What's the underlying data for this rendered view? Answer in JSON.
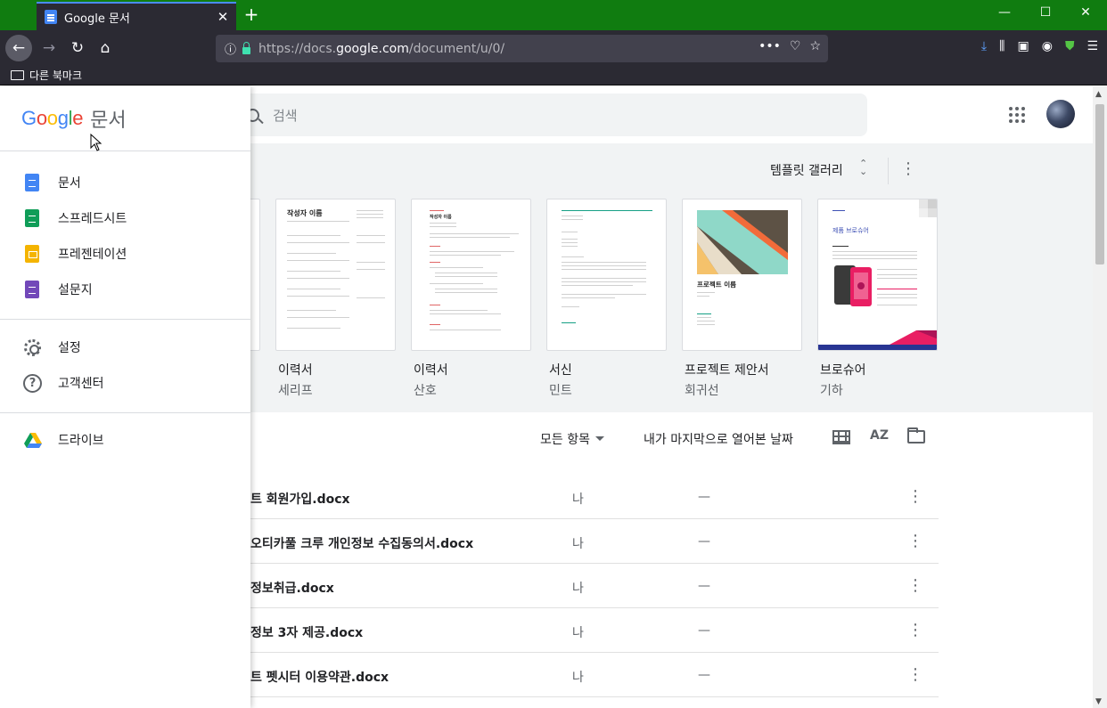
{
  "browser": {
    "tab_title": "Google 문서",
    "tab_close": "✕",
    "new_tab": "+",
    "window_controls": {
      "minimize": "—",
      "maximize": "☐",
      "close": "✕"
    },
    "nav": {
      "back": "←",
      "forward": "→",
      "reload": "↻",
      "home": "⌂"
    },
    "url_prefix": "https://docs.",
    "url_domain": "google.com",
    "url_suffix": "/document/u/0/",
    "url_actions": [
      "•••",
      "♡",
      "☆"
    ],
    "toolbar_icons": [
      "⤓",
      "⫼",
      "▣",
      "◉",
      "⛊",
      "☰"
    ],
    "bookmark_folder": "다른 북마크",
    "accent_color": "#107c10"
  },
  "search": {
    "placeholder": "검색"
  },
  "gallery": {
    "label": "템플릿 갤러리",
    "arrows": "⌃⌄",
    "more": "⋮"
  },
  "templates": [
    {
      "name": "이력서",
      "sub": "세리프",
      "heading": "작성자 이름"
    },
    {
      "name": "이력서",
      "sub": "산호",
      "heading": "작성자 이름"
    },
    {
      "name": "서신",
      "sub": "민트",
      "heading": ""
    },
    {
      "name": "프로젝트 제안서",
      "sub": "회귀선",
      "heading": "프로젝트 이름"
    },
    {
      "name": "브로슈어",
      "sub": "기하",
      "heading": "제품 브로슈어"
    }
  ],
  "list": {
    "owner_filter": "모든 항목",
    "sort_label": "내가 마지막으로 열어본 날짜",
    "sort_icon": "AZ",
    "files": [
      {
        "name": "트 회원가입.docx",
        "owner": "나",
        "date": "—"
      },
      {
        "name": "오티카풀 크루 개인정보 수집동의서.docx",
        "owner": "나",
        "date": "—"
      },
      {
        "name": "정보취급.docx",
        "owner": "나",
        "date": "—"
      },
      {
        "name": "정보 3자 제공.docx",
        "owner": "나",
        "date": "—"
      },
      {
        "name": "트 펫시터 이용약관.docx",
        "owner": "나",
        "date": "—"
      }
    ]
  },
  "drawer": {
    "logo_letters": [
      "G",
      "o",
      "o",
      "g",
      "l",
      "e"
    ],
    "product": "문서",
    "apps": [
      {
        "label": "문서",
        "icon": "docs-icon"
      },
      {
        "label": "스프레드시트",
        "icon": "sheets-icon"
      },
      {
        "label": "프레젠테이션",
        "icon": "slides-icon"
      },
      {
        "label": "설문지",
        "icon": "forms-icon"
      }
    ],
    "settings": "설정",
    "help": "고객센터",
    "drive": "드라이브",
    "help_glyph": "?"
  }
}
